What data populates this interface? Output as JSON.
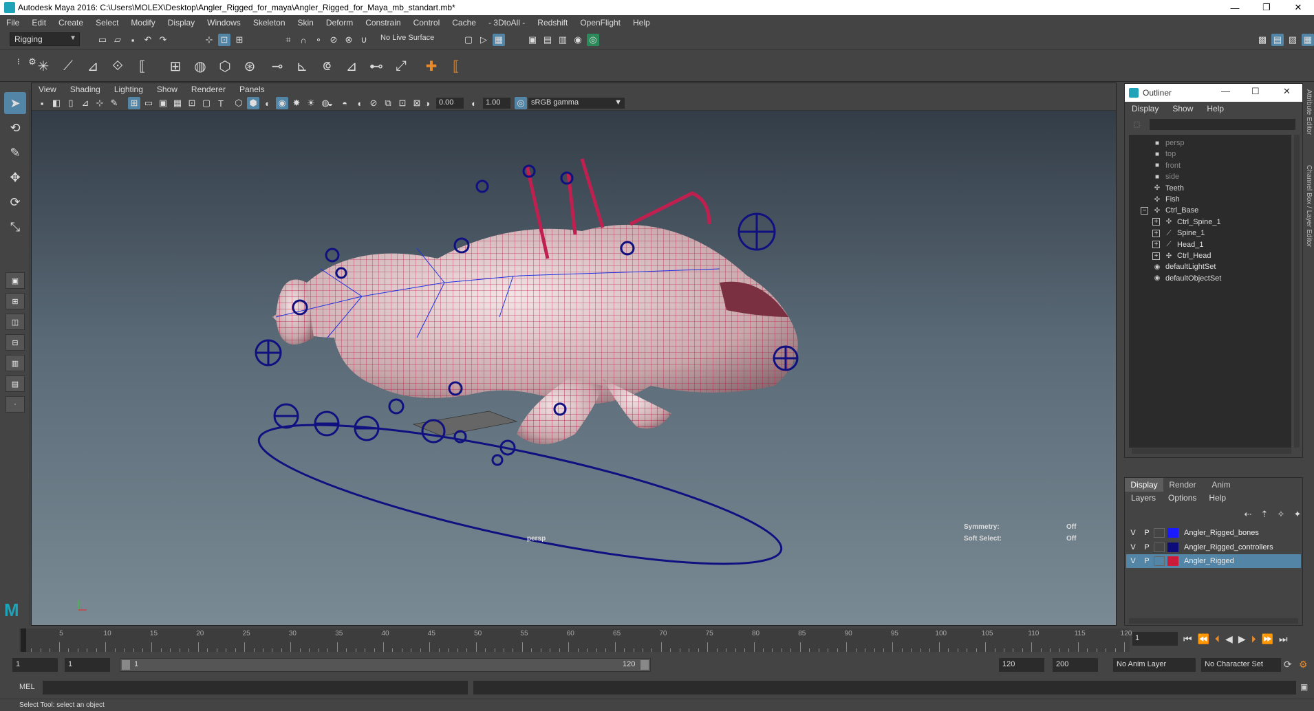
{
  "window": {
    "title": "Autodesk Maya 2016: C:\\Users\\MOLEX\\Desktop\\Angler_Rigged_for_maya\\Angler_Rigged_for_Maya_mb_standart.mb*",
    "controls": [
      "—",
      "❐",
      "✕"
    ]
  },
  "menubar": [
    "File",
    "Edit",
    "Create",
    "Select",
    "Modify",
    "Display",
    "Windows",
    "Skeleton",
    "Skin",
    "Deform",
    "Constrain",
    "Control",
    "Cache",
    "- 3DtoAll -",
    "Redshift",
    "OpenFlight",
    "Help"
  ],
  "statusline": {
    "menuset": "Rigging",
    "no_live_surface": "No Live Surface"
  },
  "viewport": {
    "menu": [
      "View",
      "Shading",
      "Lighting",
      "Show",
      "Renderer",
      "Panels"
    ],
    "near_value": "0.00",
    "far_value": "1.00",
    "color_space": "sRGB gamma",
    "camera_label": "persp",
    "hud": {
      "symmetry_label": "Symmetry:",
      "symmetry_value": "Off",
      "soft_select_label": "Soft Select:",
      "soft_select_value": "Off"
    }
  },
  "outliner": {
    "title": "Outliner",
    "menu": [
      "Display",
      "Show",
      "Help"
    ],
    "items": [
      {
        "label": "persp",
        "dim": true,
        "icon": "camera-icon",
        "indent": 0,
        "expander": ""
      },
      {
        "label": "top",
        "dim": true,
        "icon": "camera-icon",
        "indent": 0,
        "expander": ""
      },
      {
        "label": "front",
        "dim": true,
        "icon": "camera-icon",
        "indent": 0,
        "expander": ""
      },
      {
        "label": "side",
        "dim": true,
        "icon": "camera-icon",
        "indent": 0,
        "expander": ""
      },
      {
        "label": "Teeth",
        "dim": false,
        "icon": "transform-icon",
        "indent": 0,
        "expander": ""
      },
      {
        "label": "Fish",
        "dim": false,
        "icon": "transform-icon",
        "indent": 0,
        "expander": ""
      },
      {
        "label": "Ctrl_Base",
        "dim": false,
        "icon": "transform-icon",
        "indent": 0,
        "expander": "−"
      },
      {
        "label": "Ctrl_Spine_1",
        "dim": false,
        "icon": "transform-icon",
        "indent": 1,
        "expander": "+"
      },
      {
        "label": "Spine_1",
        "dim": false,
        "icon": "joint-icon",
        "indent": 1,
        "expander": "+"
      },
      {
        "label": "Head_1",
        "dim": false,
        "icon": "joint-icon",
        "indent": 1,
        "expander": "+"
      },
      {
        "label": "Ctrl_Head",
        "dim": false,
        "icon": "transform-icon",
        "indent": 1,
        "expander": "+"
      },
      {
        "label": "defaultLightSet",
        "dim": false,
        "icon": "set-icon",
        "indent": 0,
        "expander": ""
      },
      {
        "label": "defaultObjectSet",
        "dim": false,
        "icon": "set-icon",
        "indent": 0,
        "expander": ""
      }
    ]
  },
  "layer_editor": {
    "tabs": [
      "Display",
      "Render",
      "Anim"
    ],
    "menu": [
      "Layers",
      "Options",
      "Help"
    ],
    "layers": [
      {
        "v": "V",
        "p": "P",
        "name": "Angler_Rigged_bones",
        "color": "#1a1aff",
        "selected": false
      },
      {
        "v": "V",
        "p": "P",
        "name": "Angler_Rigged_controllers",
        "color": "#0d0d7a",
        "selected": false
      },
      {
        "v": "V",
        "p": "P",
        "name": "Angler_Rigged",
        "color": "#cc1a3a",
        "selected": true
      }
    ]
  },
  "timeslider": {
    "labels": [
      "1",
      "5",
      "10",
      "15",
      "20",
      "25",
      "30",
      "35",
      "40",
      "45",
      "50",
      "55",
      "60",
      "65",
      "70",
      "75",
      "80",
      "85",
      "90",
      "95",
      "100",
      "105",
      "110",
      "115",
      "120"
    ],
    "current_frame": "1"
  },
  "rangeslider": {
    "start": "1",
    "playback_start": "1",
    "bar_start": "1",
    "bar_end": "120",
    "playback_end": "120",
    "end": "200",
    "anim_layer": "No Anim Layer",
    "character_set": "No Character Set"
  },
  "cmdline": {
    "language": "MEL"
  },
  "helpline": "Select Tool: select an object"
}
